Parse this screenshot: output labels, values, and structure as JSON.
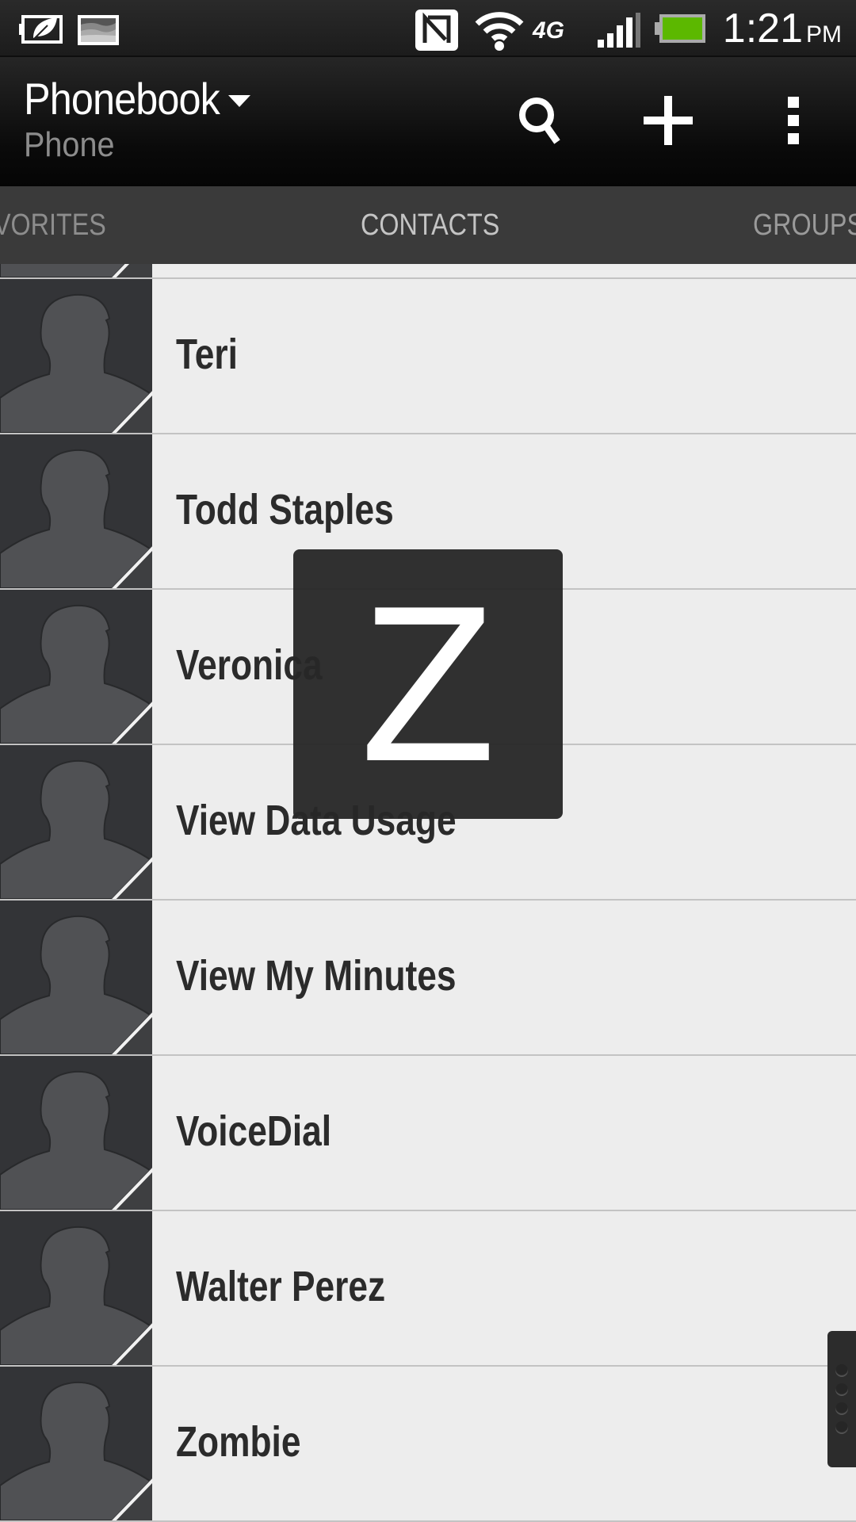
{
  "status_bar": {
    "time": "1:21",
    "ampm": "PM",
    "icons": [
      "power-saver-icon",
      "gallery-notification-icon",
      "nfc-icon",
      "wifi-icon",
      "4g-icon",
      "signal-icon",
      "battery-icon"
    ],
    "network_label": "4G",
    "battery_color": "#5cb800"
  },
  "action_bar": {
    "title": "Phonebook",
    "subtitle": "Phone",
    "buttons": [
      "search",
      "add",
      "more"
    ]
  },
  "tabs": [
    {
      "label": "FAVORITES",
      "visible_label": "VORITES"
    },
    {
      "label": "CONTACTS",
      "selected": true
    },
    {
      "label": "GROUPS",
      "visible_label": "GROUPS"
    }
  ],
  "contacts": [
    {
      "name": ""
    },
    {
      "name": "Teri"
    },
    {
      "name": "Todd Staples"
    },
    {
      "name": "Veronica"
    },
    {
      "name": "View Data Usage"
    },
    {
      "name": "View My Minutes"
    },
    {
      "name": "VoiceDial"
    },
    {
      "name": "Walter Perez"
    },
    {
      "name": "Zombie"
    }
  ],
  "index_overlay": {
    "letter": "Z"
  }
}
